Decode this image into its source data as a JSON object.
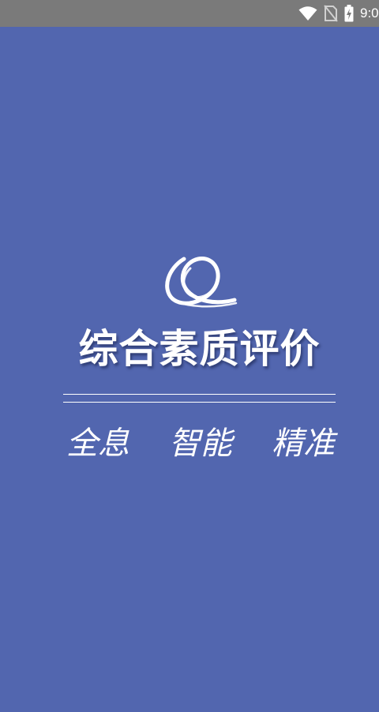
{
  "status_bar": {
    "time": "9:0",
    "icons": [
      "wifi-icon",
      "no-sim-icon",
      "battery-charging-icon"
    ]
  },
  "splash": {
    "logo": "q-swirl-logo",
    "title": "综合素质评价",
    "slogan": [
      "全息",
      "智能",
      "精准"
    ]
  },
  "colors": {
    "background": "#5266af",
    "status_bar": "#7a7a7a",
    "text": "#ffffff"
  }
}
